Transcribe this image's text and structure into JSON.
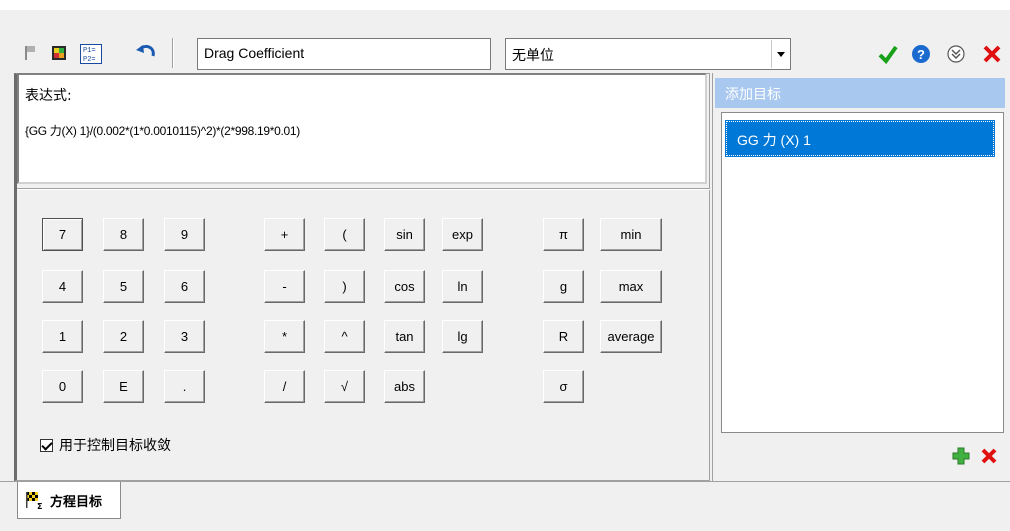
{
  "toolbar": {
    "icons": [
      "flag-icon",
      "colored-chart-icon",
      "p1-p2-equation-icon",
      "undo-icon"
    ],
    "name_value": "Drag Coefficient",
    "unit_value": "无单位"
  },
  "header_buttons": [
    "ok-check-icon",
    "help-icon",
    "collapse-icon",
    "close-icon"
  ],
  "expression": {
    "label": "表达式:",
    "text": "{GG 力(X) 1}/(0.002*(1*0.0010115)^2)*(2*998.19*0.01)"
  },
  "keypad": {
    "rows": [
      [
        "7",
        "8",
        "9",
        "+",
        "(",
        "sin",
        "exp",
        "π",
        "min"
      ],
      [
        "4",
        "5",
        "6",
        "-",
        ")",
        "cos",
        "ln",
        "g",
        "max"
      ],
      [
        "1",
        "2",
        "3",
        "*",
        "^",
        "tan",
        "lg",
        "R",
        "average"
      ],
      [
        "0",
        "E",
        ".",
        "/",
        "√",
        "abs",
        "",
        "σ",
        ""
      ]
    ]
  },
  "checkbox": {
    "label": "用于控制目标收敛",
    "checked": true
  },
  "targets": {
    "header": "添加目标",
    "items": [
      "GG 力 (X) 1"
    ],
    "colors": {
      "header_bg": "#a8c8ef",
      "selected_bg": "#0078d7"
    }
  },
  "tab": {
    "label": "方程目标",
    "icon": "checkered-flag-sigma-icon"
  }
}
